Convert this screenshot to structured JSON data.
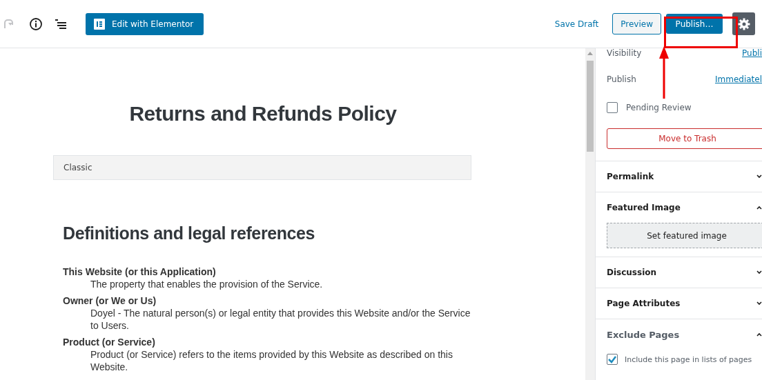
{
  "toolbar": {
    "redo_disabled": true,
    "elementor_button": "Edit with Elementor",
    "save_draft": "Save Draft",
    "preview": "Preview",
    "publish": "Publish…"
  },
  "document": {
    "title": "Returns and Refunds Policy",
    "block_label": "Classic",
    "heading": "Definitions and legal references",
    "definitions": [
      {
        "term": "This Website (or this Application)",
        "description": "The property that enables the provision of the Service."
      },
      {
        "term": "Owner (or We or Us)",
        "description": "Doyel - The natural person(s) or legal entity that provides this Website and/or the Service to Users."
      },
      {
        "term": "Product (or Service)",
        "description": "Product (or Service) refers to the items provided by this Website as described on this Website."
      }
    ]
  },
  "sidebar": {
    "status_rows": [
      {
        "label": "Visibility",
        "value": "Publi"
      },
      {
        "label": "Publish",
        "value": "Immediatel"
      }
    ],
    "pending_review": {
      "label": "Pending Review",
      "checked": false
    },
    "trash_button": "Move to Trash",
    "panels": [
      {
        "title": "Permalink",
        "expanded": false
      },
      {
        "title": "Featured Image",
        "expanded": true,
        "button": "Set featured image"
      },
      {
        "title": "Discussion",
        "expanded": false
      },
      {
        "title": "Page Attributes",
        "expanded": false
      },
      {
        "title": "Exclude Pages",
        "expanded": true,
        "muted": true,
        "checkbox": {
          "label": "Include this page in lists of pages",
          "checked": true
        }
      }
    ]
  }
}
